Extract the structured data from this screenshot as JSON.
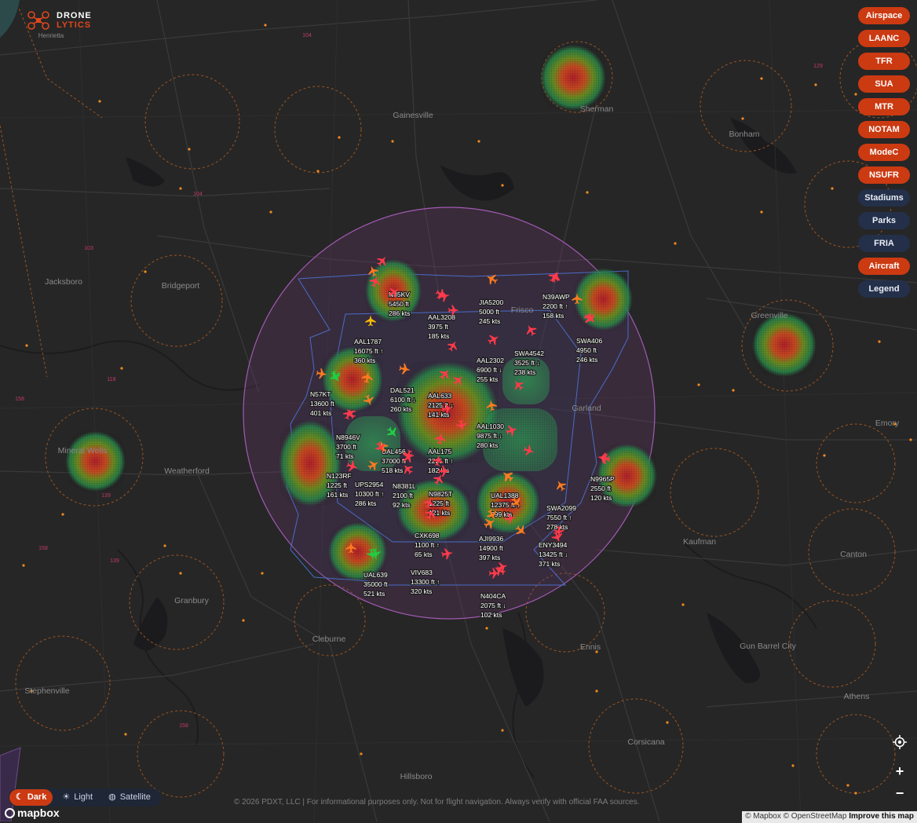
{
  "app": {
    "brand_line1": "DRONE",
    "brand_line2": "LYTICS",
    "brand_color": "#e0461c"
  },
  "layers": [
    {
      "label": "Airspace",
      "active": true
    },
    {
      "label": "LAANC",
      "active": true
    },
    {
      "label": "TFR",
      "active": true
    },
    {
      "label": "SUA",
      "active": true
    },
    {
      "label": "MTR",
      "active": true
    },
    {
      "label": "NOTAM",
      "active": true
    },
    {
      "label": "ModeC",
      "active": true
    },
    {
      "label": "NSUFR",
      "active": true
    },
    {
      "label": "Stadiums",
      "active": false
    },
    {
      "label": "Parks",
      "active": false
    },
    {
      "label": "FRIA",
      "active": false
    },
    {
      "label": "Aircraft",
      "active": true
    },
    {
      "label": "Legend",
      "active": false
    }
  ],
  "map_styles": {
    "dark": "Dark",
    "light": "Light",
    "satellite": "Satellite",
    "selected": "Dark"
  },
  "controls": {
    "locate_icon": "crosshair-icon",
    "zoom_in": "+",
    "zoom_out": "−"
  },
  "footer": {
    "disclaimer": "© 2026 PDXT, LLC | For informational purposes only. Not for flight navigation. Always verify with official FAA sources.",
    "mapbox": "mapbox",
    "attrib_mapbox": "© Mapbox",
    "attrib_osm": "© OpenStreetMap",
    "attrib_improve": "Improve this map"
  },
  "colors": {
    "accent": "#cc3a12",
    "mode_c": "#a25ab4",
    "class_b": "#4a6cc8",
    "class_e": "#c8641e",
    "ac_red": "#ff3a4a",
    "ac_orange": "#ff7a1e",
    "ac_green": "#22cc44",
    "ac_yellow": "#ffbb00"
  },
  "places": [
    {
      "name": "Henrietta"
    },
    {
      "name": "Gainesville"
    },
    {
      "name": "Sherman"
    },
    {
      "name": "Bonham"
    },
    {
      "name": "Jacksboro"
    },
    {
      "name": "Bridgeport"
    },
    {
      "name": "Frisco"
    },
    {
      "name": "Greenville"
    },
    {
      "name": "Garland"
    },
    {
      "name": "Emory"
    },
    {
      "name": "Mineral Wells"
    },
    {
      "name": "Weatherford"
    },
    {
      "name": "Kaufman"
    },
    {
      "name": "Canton"
    },
    {
      "name": "Granbury"
    },
    {
      "name": "Cleburne"
    },
    {
      "name": "Ennis"
    },
    {
      "name": "Gun Barrel City"
    },
    {
      "name": "Stephenville"
    },
    {
      "name": "Athens"
    },
    {
      "name": "Corsicana"
    },
    {
      "name": "Hillsboro"
    }
  ],
  "roads": [
    "104",
    "104",
    "103",
    "129",
    "118",
    "158",
    "139",
    "158",
    "139",
    "158"
  ],
  "aircraft": [
    {
      "callsign": "N35KV",
      "alt": "5450 ft",
      "trend": "",
      "speed": "286 kts",
      "color": "red"
    },
    {
      "callsign": "JIA5200",
      "alt": "5000 ft",
      "trend": "",
      "speed": "245 kts",
      "color": "orange"
    },
    {
      "callsign": "N39AWP",
      "alt": "2200 ft",
      "trend": "↑",
      "speed": "158 kts",
      "color": "red"
    },
    {
      "callsign": "AAL3208",
      "alt": "3975 ft",
      "trend": "",
      "speed": "185 kts",
      "color": "red"
    },
    {
      "callsign": "SWA406",
      "alt": "4950 ft",
      "trend": "",
      "speed": "246 kts",
      "color": "red"
    },
    {
      "callsign": "AAL1787",
      "alt": "16075 ft",
      "trend": "↑",
      "speed": "360 kts",
      "color": "orange"
    },
    {
      "callsign": "SWA4542",
      "alt": "3525 ft",
      "trend": "↓",
      "speed": "238 kts",
      "color": "red"
    },
    {
      "callsign": "AAL2302",
      "alt": "6900 ft",
      "trend": "↓",
      "speed": "255 kts",
      "color": "red"
    },
    {
      "callsign": "DAL521",
      "alt": "6100 ft",
      "trend": "↓",
      "speed": "260 kts",
      "color": "orange"
    },
    {
      "callsign": "N57KT",
      "alt": "13600 ft",
      "trend": "",
      "speed": "401 kts",
      "color": "green"
    },
    {
      "callsign": "AAL633",
      "alt": "2125 ft",
      "trend": "↓",
      "speed": "141 kts",
      "color": "red"
    },
    {
      "callsign": "AAL1030",
      "alt": "9875 ft",
      "trend": "↓",
      "speed": "280 kts",
      "color": "red"
    },
    {
      "callsign": "N8946V",
      "alt": "3700 ft",
      "trend": "",
      "speed": "71 kts",
      "color": "red"
    },
    {
      "callsign": "UAL456",
      "alt": "37000 ft",
      "trend": "",
      "speed": "518 kts",
      "color": "green"
    },
    {
      "callsign": "AAL175",
      "alt": "2225 ft",
      "trend": "↑",
      "speed": "182 kts",
      "color": "red"
    },
    {
      "callsign": "N9965P",
      "alt": "2550 ft",
      "trend": "",
      "speed": "120 kts",
      "color": "red"
    },
    {
      "callsign": "N123RF",
      "alt": "1225 ft",
      "trend": "",
      "speed": "161 kts",
      "color": "red"
    },
    {
      "callsign": "UPS2954",
      "alt": "10300 ft",
      "trend": "↑",
      "speed": "286 kts",
      "color": "orange"
    },
    {
      "callsign": "N8381L",
      "alt": "2100 ft",
      "trend": "",
      "speed": "92 kts",
      "color": "red"
    },
    {
      "callsign": "N9825T",
      "alt": "1225 ft",
      "trend": "",
      "speed": "121 kts",
      "color": "red"
    },
    {
      "callsign": "UAL1388",
      "alt": "12375 ft",
      "trend": "↓",
      "speed": "299 kts",
      "color": "orange"
    },
    {
      "callsign": "SWA2099",
      "alt": "7550 ft",
      "trend": "↑",
      "speed": "278 kts",
      "color": "orange"
    },
    {
      "callsign": "CXK698",
      "alt": "1100 ft",
      "trend": "↑",
      "speed": "65 kts",
      "color": "red"
    },
    {
      "callsign": "AJI9936",
      "alt": "14900 ft",
      "trend": "",
      "speed": "397 kts",
      "color": "orange"
    },
    {
      "callsign": "ENY3494",
      "alt": "13425 ft",
      "trend": "↓",
      "speed": "371 kts",
      "color": "red"
    },
    {
      "callsign": "VIV683",
      "alt": "13300 ft",
      "trend": "↑",
      "speed": "320 kts",
      "color": "red"
    },
    {
      "callsign": "UAL639",
      "alt": "35000 ft",
      "trend": "",
      "speed": "521 kts",
      "color": "green"
    },
    {
      "callsign": "N404CA",
      "alt": "2075 ft",
      "trend": "↓",
      "speed": "102 kts",
      "color": "red"
    }
  ]
}
